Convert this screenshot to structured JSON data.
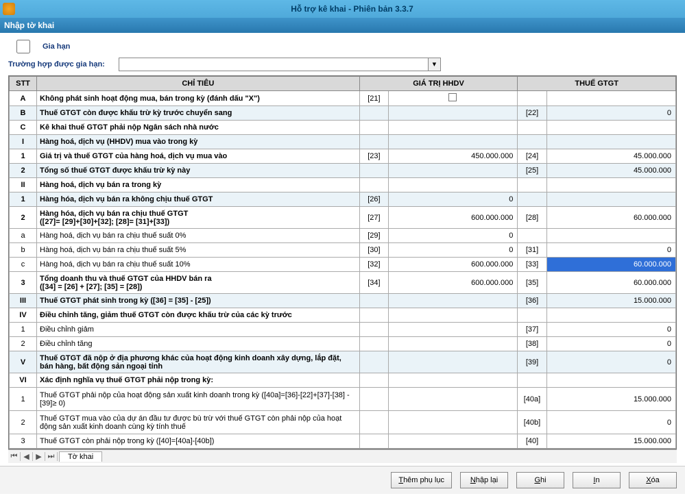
{
  "title": "Hỗ trợ kê khai - Phiên bản 3.3.7",
  "menubar": "Nhập tờ khai",
  "topCheckbox": "Gia hạn",
  "extensionLabel": "Trường hợp được gia hạn:",
  "headers": {
    "stt": "STT",
    "chitieu": "CHỈ TIÊU",
    "hhdv": "GIÁ TRỊ HHDV",
    "gtgt": "THUẾ GTGT"
  },
  "rows": [
    {
      "stt": "A",
      "label": "Không phát sinh hoạt động mua, bán trong kỳ (đánh dấu \"X\")",
      "c1": "[21]",
      "checkbox": true
    },
    {
      "stt": "B",
      "label": "Thuế GTGT còn được khấu trừ kỳ trước chuyển sang",
      "c2": "[22]",
      "v2": "0",
      "section": true
    },
    {
      "stt": "C",
      "label": "Kê khai thuế GTGT phải nộp Ngân sách nhà nước"
    },
    {
      "stt": "I",
      "label": "Hàng hoá, dịch vụ (HHDV) mua vào trong kỳ",
      "section": true
    },
    {
      "stt": "1",
      "label": "Giá trị và thuế GTGT của hàng hoá, dịch vụ mua vào",
      "c1": "[23]",
      "v1": "450.000.000",
      "c2": "[24]",
      "v2": "45.000.000"
    },
    {
      "stt": "2",
      "label": "Tổng số thuế GTGT  được khấu trừ kỳ này",
      "c2": "[25]",
      "v2": "45.000.000",
      "section": true
    },
    {
      "stt": "II",
      "label": "Hàng hoá, dịch vụ bán ra trong kỳ"
    },
    {
      "stt": "1",
      "label": "Hàng hóa, dịch vụ bán ra không chịu thuế GTGT",
      "c1": "[26]",
      "v1": "0",
      "section": true
    },
    {
      "stt": "2",
      "label": "Hàng hóa, dịch vụ bán ra chịu thuế GTGT\n([27]= [29]+[30]+[32]; [28]= [31]+[33])",
      "c1": "[27]",
      "v1": "600.000.000",
      "c2": "[28]",
      "v2": "60.000.000",
      "twoLine": true
    },
    {
      "stt": "a",
      "label": "Hàng hoá, dịch vụ bán ra chịu thuế suất 0%",
      "light": true,
      "c1": "[29]",
      "v1": "0"
    },
    {
      "stt": "b",
      "label": "Hàng hoá, dịch vụ bán ra chịu thuế suất 5%",
      "light": true,
      "c1": "[30]",
      "v1": "0",
      "c2": "[31]",
      "v2": "0"
    },
    {
      "stt": "c",
      "label": "Hàng hoá, dịch vụ bán ra chịu thuế suất 10%",
      "light": true,
      "c1": "[32]",
      "v1": "600.000.000",
      "c2": "[33]",
      "v2": "60.000.000",
      "selected": true
    },
    {
      "stt": "3",
      "label": "Tổng doanh thu và thuế GTGT của HHDV bán  ra\n([34] = [26] + [27]; [35] = [28])",
      "c1": "[34]",
      "v1": "600.000.000",
      "c2": "[35]",
      "v2": "60.000.000",
      "twoLine": true
    },
    {
      "stt": "III",
      "label": "Thuế GTGT phát sinh trong kỳ ([36] = [35] - [25])",
      "c2": "[36]",
      "v2": "15.000.000",
      "section": true
    },
    {
      "stt": "IV",
      "label": "Điều chỉnh tăng, giảm thuế GTGT còn được khấu trừ của các kỳ trước"
    },
    {
      "stt": "1",
      "label": "Điều chỉnh giảm",
      "light": true,
      "c2": "[37]",
      "v2": "0"
    },
    {
      "stt": "2",
      "label": "Điều chỉnh tăng",
      "light": true,
      "c2": "[38]",
      "v2": "0"
    },
    {
      "stt": "V",
      "label": "Thuế GTGT đã nộp ở địa phương khác của hoạt động kinh doanh xây dựng, lắp đặt, bán hàng, bất động sản ngoại tỉnh",
      "c2": "[39]",
      "v2": "0",
      "twoLine": true,
      "section": true
    },
    {
      "stt": "VI",
      "label": "Xác định nghĩa vụ thuế GTGT phải nộp trong kỳ:"
    },
    {
      "stt": "1",
      "label": "Thuế GTGT phải nộp của hoạt động sản xuất kinh doanh trong kỳ ([40a]=[36]-[22]+[37]-[38] - [39]≥ 0)",
      "light": true,
      "c2": "[40a]",
      "v2": "15.000.000",
      "tall": true
    },
    {
      "stt": "2",
      "label": "Thuế GTGT mua vào của dự án đầu tư được bù trừ với thuế GTGT còn phải nộp của hoạt động sản xuất kinh doanh cùng kỳ tính thuế",
      "light": true,
      "c2": "[40b]",
      "v2": "0",
      "tall": true
    },
    {
      "stt": "3",
      "label": "Thuế GTGT còn phải nộp trong kỳ ([40]=[40a]-[40b])",
      "light": true,
      "c2": "[40]",
      "v2": "15.000.000"
    }
  ],
  "sheetTab": "Tờ khai",
  "buttons": {
    "themphuluc": "Thêm phụ lục",
    "nhaplai": "Nhập lại",
    "ghi": "Ghi",
    "in": "In",
    "xoa": "Xóa"
  }
}
